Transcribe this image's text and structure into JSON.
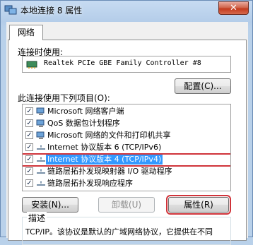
{
  "window": {
    "title": "本地连接 8 属性",
    "close_glyph": "✕"
  },
  "tabs": [
    {
      "label": "网络"
    }
  ],
  "connect_using_label": "连接时使用:",
  "adapter": {
    "name": "Realtek PCIe GBE Family Controller #8"
  },
  "configure_button": "配置(C)...",
  "items_label": "此连接使用下列项目(O):",
  "items": [
    {
      "label": "Microsoft 网络客户端",
      "checked": true,
      "icon": "network-client-icon"
    },
    {
      "label": "QoS 数据包计划程序",
      "checked": true,
      "icon": "qos-icon"
    },
    {
      "label": "Microsoft 网络的文件和打印机共享",
      "checked": true,
      "icon": "file-share-icon"
    },
    {
      "label": "Internet 协议版本 6 (TCP/IPv6)",
      "checked": true,
      "icon": "protocol-icon"
    },
    {
      "label": "Internet 协议版本 4 (TCP/IPv4)",
      "checked": true,
      "icon": "protocol-icon",
      "selected": true
    },
    {
      "label": "链路层拓扑发现映射器 I/O 驱动程序",
      "checked": true,
      "icon": "protocol-icon"
    },
    {
      "label": "链路层拓扑发现响应程序",
      "checked": true,
      "icon": "protocol-icon"
    }
  ],
  "buttons": {
    "install": "安装(N)...",
    "uninstall": "卸载(U)",
    "properties": "属性(R)"
  },
  "description": {
    "title": "描述",
    "text": "TCP/IP。该协议是默认的广域网络协议，它提供在不同"
  },
  "colors": {
    "selection": "#3399ff",
    "highlight_frame": "#d0343a"
  }
}
